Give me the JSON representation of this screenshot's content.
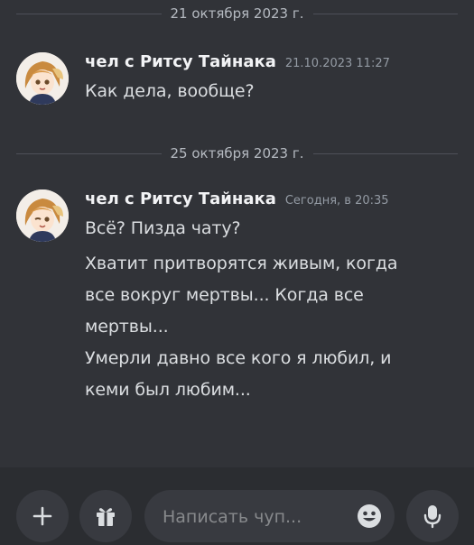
{
  "chat": {
    "dividers": [
      {
        "date": "21 октября 2023 г."
      },
      {
        "date": "25 октября 2023 г."
      }
    ],
    "messages": [
      {
        "author": "чел с Ритсу Тайнака",
        "timestamp": "21.10.2023 11:27",
        "lines": [
          "Как дела, вообще?"
        ]
      },
      {
        "author": "чел с Ритсу Тайнака",
        "timestamp": "Сегодня, в 20:35",
        "lines": [
          "Всё? Пизда чату?",
          "Хватит притворятся живым, когда",
          "все вокруг мертвы... Когда все",
          "мертвы...",
          "Умерли давно все кого я любил, и",
          "кеми был любим..."
        ]
      }
    ]
  },
  "composer": {
    "plus_icon": "plus-icon",
    "gift_icon": "gift-icon",
    "placeholder": "Написать чуп...",
    "emoji_icon": "emoji-icon",
    "mic_icon": "microphone-icon"
  },
  "colors": {
    "background": "#313338",
    "composer_bar": "#2b2d31",
    "button": "#383a40"
  }
}
